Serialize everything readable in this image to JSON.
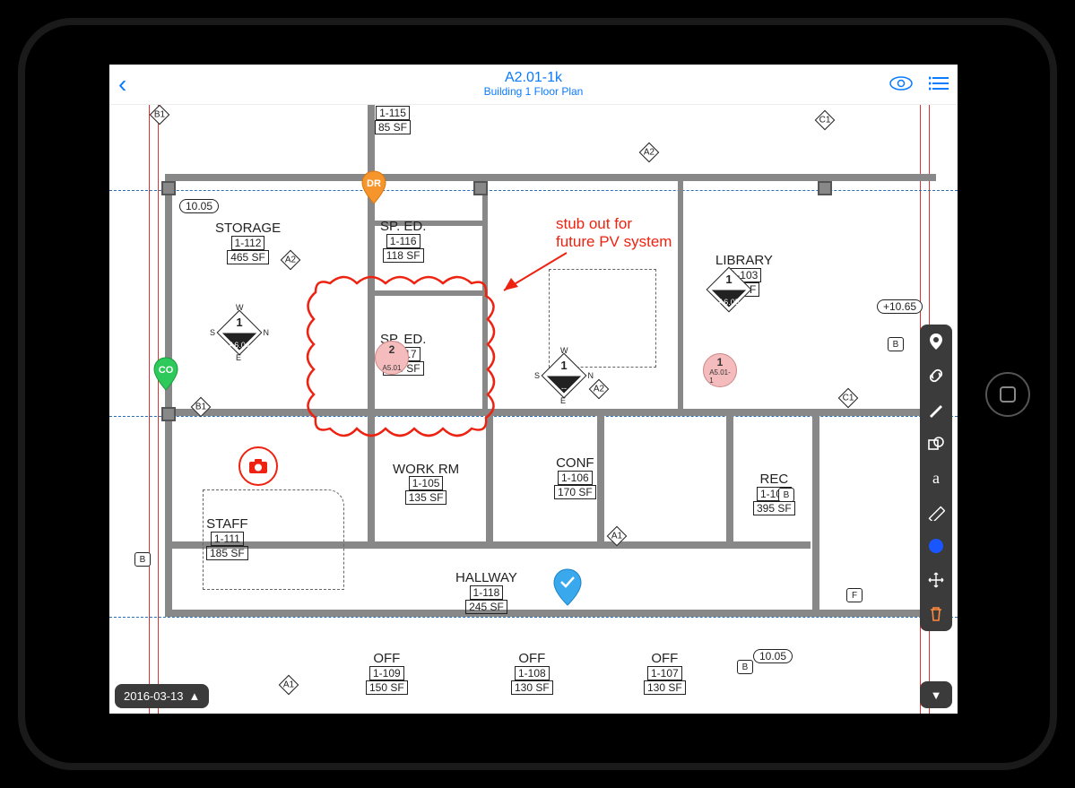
{
  "title": {
    "line1": "A2.01-1k",
    "line2": "Building 1 Floor Plan"
  },
  "date": "2016-03-13",
  "annotation": {
    "line1": "stub out for",
    "line2": "future PV system"
  },
  "rooms": [
    {
      "name": "STORAGE",
      "id": "1-112",
      "sf": "465 SF"
    },
    {
      "name": "SP. ED.",
      "id": "1-116",
      "sf": "118 SF"
    },
    {
      "name": "SP. ED.",
      "id": "1-117",
      "sf": "118 SF"
    },
    {
      "name": "LIBRARY",
      "id": "1-103",
      "sf": "-- SF"
    },
    {
      "name": "STAFF",
      "id": "1-111",
      "sf": "185 SF"
    },
    {
      "name": "WORK RM",
      "id": "1-105",
      "sf": "135 SF"
    },
    {
      "name": "CONF",
      "id": "1-106",
      "sf": "170 SF"
    },
    {
      "name": "REC",
      "id": "1-104",
      "sf": "395 SF"
    },
    {
      "name": "HALLWAY",
      "id": "1-118",
      "sf": "245 SF"
    },
    {
      "name": "OFF",
      "id": "1-109",
      "sf": "150 SF"
    },
    {
      "name": "OFF",
      "id": "1-108",
      "sf": "130 SF"
    },
    {
      "name": "OFF",
      "id": "1-107",
      "sf": "130 SF"
    }
  ],
  "room_top": {
    "id": "1-115",
    "sf": "85 SF"
  },
  "ovals": [
    "10.05",
    "10.05",
    "+10.65"
  ],
  "diamonds": [
    {
      "num": "1",
      "ref": "A6.04"
    },
    {
      "num": "2",
      "ref": "A5.01"
    },
    {
      "num": "1",
      "ref": "--"
    },
    {
      "num": "1",
      "ref": "A6.05"
    },
    {
      "num": "1",
      "ref": "A5.01-1"
    }
  ],
  "pins": {
    "green": "CO",
    "orange": "DR",
    "blue": "✓"
  },
  "gridA": [
    "A1",
    "A2",
    "A2",
    "A2",
    "A1",
    "C1",
    "C1",
    "B1",
    "B1"
  ],
  "gridB": [
    "B",
    "B",
    "B",
    "B",
    "F"
  ],
  "compass": [
    "N",
    "S",
    "E",
    "W"
  ]
}
